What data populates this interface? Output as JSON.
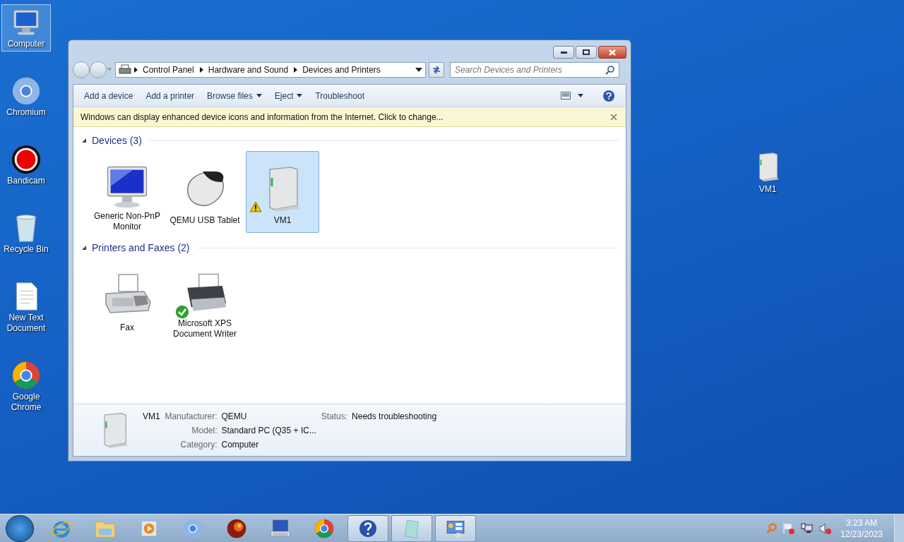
{
  "desktop_icons": [
    {
      "label": "Computer",
      "kind": "computer",
      "selected": true
    },
    {
      "label": "Chromium",
      "kind": "chromium",
      "selected": false
    },
    {
      "label": "Bandicam",
      "kind": "record",
      "selected": false
    },
    {
      "label": "Recycle Bin",
      "kind": "bin",
      "selected": false
    },
    {
      "label": "New Text Document",
      "kind": "document",
      "selected": false
    },
    {
      "label": "Google Chrome",
      "kind": "chrome",
      "selected": false
    }
  ],
  "desktop_right_icon": {
    "label": "VM1",
    "kind": "drive",
    "selected": false
  },
  "window": {
    "breadcrumb": [
      "Control Panel",
      "Hardware and Sound",
      "Devices and Printers"
    ],
    "search": {
      "placeholder": "Search Devices and Printers"
    },
    "toolbar": [
      {
        "label": "Add a device",
        "dropdown": false
      },
      {
        "label": "Add a printer",
        "dropdown": false
      },
      {
        "label": "Browse files",
        "dropdown": true
      },
      {
        "label": "Eject",
        "dropdown": true
      },
      {
        "label": "Troubleshoot",
        "dropdown": false
      }
    ],
    "infobar": "Windows can display enhanced device icons and information from the Internet. Click to change...",
    "groups": [
      {
        "title": "Devices (3)",
        "expanded": true,
        "items": [
          {
            "label": "Generic Non-PnP Monitor",
            "kind": "monitor",
            "selected": false,
            "warning": false,
            "default": false
          },
          {
            "label": "QEMU USB Tablet",
            "kind": "mouse",
            "selected": false,
            "warning": false,
            "default": false
          },
          {
            "label": "VM1",
            "kind": "drive",
            "selected": true,
            "warning": true,
            "default": false
          }
        ]
      },
      {
        "title": "Printers and Faxes (2)",
        "expanded": true,
        "items": [
          {
            "label": "Fax",
            "kind": "fax",
            "selected": false,
            "warning": false,
            "default": false
          },
          {
            "label": "Microsoft XPS Document Writer",
            "kind": "printer",
            "selected": false,
            "warning": false,
            "default": true
          }
        ]
      }
    ],
    "details": {
      "name": "VM1",
      "kind": "drive",
      "fields": [
        {
          "label": "Manufacturer:",
          "value": "QEMU"
        },
        {
          "label": "Model:",
          "value": "Standard PC (Q35 + IC..."
        },
        {
          "label": "Category:",
          "value": "Computer"
        }
      ],
      "status": {
        "label": "Status:",
        "value": "Needs troubleshooting"
      }
    }
  },
  "taskbar": {
    "items": [
      {
        "kind": "ie",
        "active": false
      },
      {
        "kind": "folder",
        "active": false
      },
      {
        "kind": "media",
        "active": false
      },
      {
        "kind": "chromium",
        "active": false
      },
      {
        "kind": "firefox",
        "active": false
      },
      {
        "kind": "keyboard",
        "active": false
      },
      {
        "kind": "chrome",
        "active": false
      },
      {
        "kind": "help",
        "active": true
      },
      {
        "kind": "notepad",
        "active": true
      },
      {
        "kind": "devices",
        "active": true
      }
    ],
    "time": "3:23 AM",
    "date": "12/23/2023"
  }
}
